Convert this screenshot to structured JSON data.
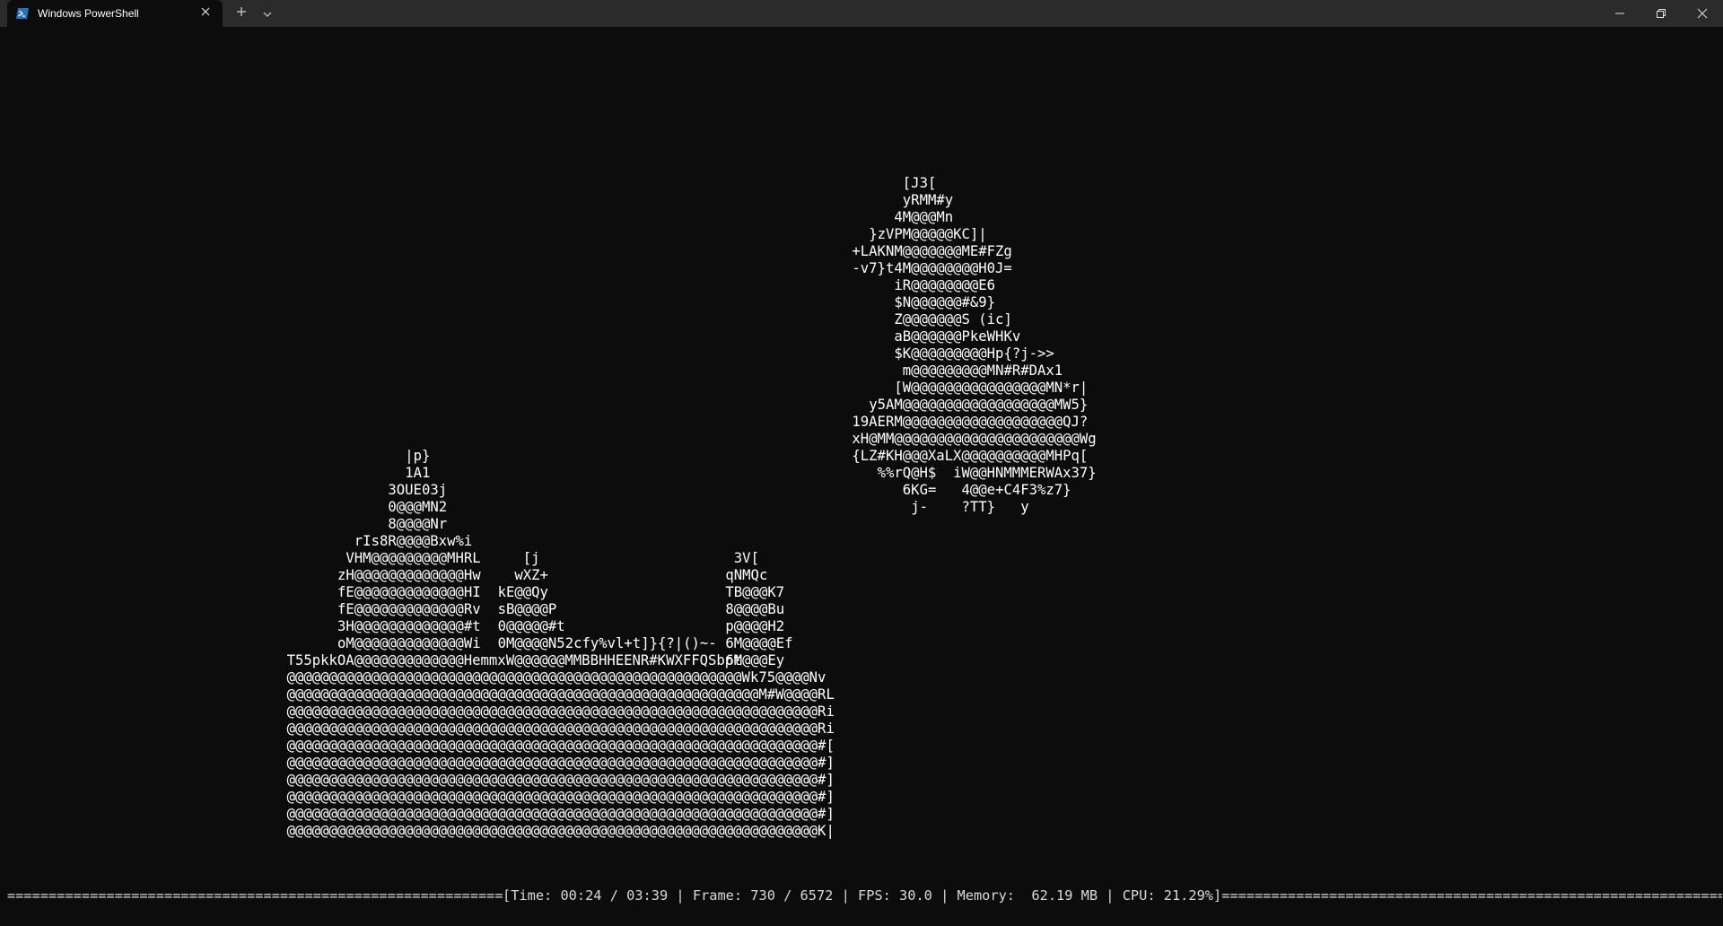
{
  "window": {
    "tab_title": "Windows PowerShell",
    "icons": {
      "tab_icon": "powershell-icon",
      "tab_close": "close-icon",
      "new_tab": "plus-icon",
      "dropdown": "chevron-down-icon",
      "minimize": "minimize-icon",
      "maximize": "restore-icon",
      "close": "close-icon"
    },
    "colors": {
      "background": "#0c0c0c",
      "titlebar": "#2b2b2b",
      "text": "#ffffff"
    }
  },
  "ascii_art": {
    "rows": [
      "[J3[",
      "yRMM#y",
      "4M@@@Mn",
      "}zVPM@@@@@KC]|",
      "+LAKNM@@@@@@@ME#FZg",
      "-v7}t4M@@@@@@@@H0J=",
      "iR@@@@@@@@E6",
      "$N@@@@@@#&9}",
      "Z@@@@@@@S (ic]",
      "aB@@@@@@PkeWHKv",
      "$K@@@@@@@@@Hp{?j->>",
      "m@@@@@@@@@MN#R#DAx1",
      "[W@@@@@@@@@@@@@@@@MN*r|",
      "y5AM@@@@@@@@@@@@@@@@@@MW5}",
      "19AERM@@@@@@@@@@@@@@@@@@@QJ?",
      "xH@MM@@@@@@@@@@@@@@@@@@@@@@Wg",
      "{LZ#KH@@@XaLX@@@@@@@@@@MHPq[",
      "%%rQ@H$  iW@@HNMMMERWAx37}",
      "6KG=   4@@e+C4F3%z7}",
      "j-    ?TT}   y",
      "|p}",
      "1A1",
      "3OUE03j",
      "0@@@MN2",
      "8@@@@Nr",
      "rIs8R@@@@Bxw%i",
      "VHM@@@@@@@@@MHRL",
      "[j",
      "3V[",
      "zH@@@@@@@@@@@@@Hw",
      "wXZ+",
      "qNMQc",
      "fE@@@@@@@@@@@@@HI",
      "kE@@Qy",
      "TB@@@K7",
      "fE@@@@@@@@@@@@@Rv",
      "sB@@@@P",
      "8@@@@Bu",
      "3H@@@@@@@@@@@@@#t",
      "0@@@@@#t",
      "p@@@@H2",
      "oM@@@@@@@@@@@@@Wi",
      "0M@@@@N52cfy%vl+t]}{?|()~-",
      "6M@@@@Ef",
      "T55pkkOA@@@@@@@@@@@@@HemmxW@@@@@@MMBBHHEENR#KWXFFQSbpt",
      "6M@@@Ey",
      "@@@@@@@@@@@@@@@@@@@@@@@@@@@@@@@@@@@@@@@@@@@@@@@@@@@@@@Wk75@@@@Nv",
      "@@@@@@@@@@@@@@@@@@@@@@@@@@@@@@@@@@@@@@@@@@@@@@@@@@@@@@@@M#W@@@@RL",
      "@@@@@@@@@@@@@@@@@@@@@@@@@@@@@@@@@@@@@@@@@@@@@@@@@@@@@@@@@@@@@@@Ri",
      "@@@@@@@@@@@@@@@@@@@@@@@@@@@@@@@@@@@@@@@@@@@@@@@@@@@@@@@@@@@@@@@Ri",
      "@@@@@@@@@@@@@@@@@@@@@@@@@@@@@@@@@@@@@@@@@@@@@@@@@@@@@@@@@@@@@@@#[",
      "@@@@@@@@@@@@@@@@@@@@@@@@@@@@@@@@@@@@@@@@@@@@@@@@@@@@@@@@@@@@@@@#]",
      "@@@@@@@@@@@@@@@@@@@@@@@@@@@@@@@@@@@@@@@@@@@@@@@@@@@@@@@@@@@@@@@#]",
      "@@@@@@@@@@@@@@@@@@@@@@@@@@@@@@@@@@@@@@@@@@@@@@@@@@@@@@@@@@@@@@@#]",
      "@@@@@@@@@@@@@@@@@@@@@@@@@@@@@@@@@@@@@@@@@@@@@@@@@@@@@@@@@@@@@@@#]",
      "@@@@@@@@@@@@@@@@@@@@@@@@@@@@@@@@@@@@@@@@@@@@@@@@@@@@@@@@@@@@@@@K|"
    ]
  },
  "status": {
    "text": "[Time: 00:24 / 03:39 | Frame: 730 / 6572 | FPS: 30.0 | Memory:  62.19 MB | CPU: 21.29%]",
    "time_current": "00:24",
    "time_total": "03:39",
    "frame_current": "730",
    "frame_total": "6572",
    "fps": "30.0",
    "memory": "62.19 MB",
    "cpu": "21.29%"
  }
}
